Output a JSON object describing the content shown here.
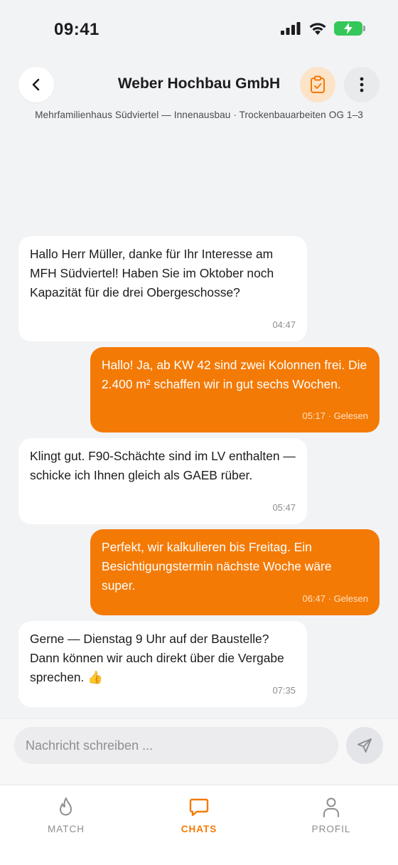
{
  "status_bar": {
    "time": "09:41"
  },
  "header": {
    "title": "Weber Hochbau GmbH",
    "subtitle": "Mehrfamilienhaus Südviertel — Innenausbau · Trockenbauarbeiten OG 1–3"
  },
  "messages": [
    {
      "direction": "in",
      "text": "Hallo Herr Müller, danke für Ihr Interesse am MFH Südviertel! Haben Sie im Oktober noch Kapazität für die drei Obergeschosse?",
      "meta": "04:47"
    },
    {
      "direction": "out",
      "text": "Hallo! Ja, ab KW 42 sind zwei Kolonnen frei. Die 2.400 m² schaffen wir in gut sechs Wochen.",
      "meta": "05:17 · Gelesen"
    },
    {
      "direction": "in",
      "text": "Klingt gut. F90-Schächte sind im LV enthalten — schicke ich Ihnen gleich als GAEB rüber.",
      "meta": "05:47"
    },
    {
      "direction": "out",
      "text": "Perfekt, wir kalkulieren bis Freitag. Ein Besichtigungstermin nächste Woche wäre super.",
      "meta": "06:47 · Gelesen"
    },
    {
      "direction": "in",
      "text": "Gerne — Dienstag 9 Uhr auf der Baustelle? Dann können wir auch direkt über die Vergabe sprechen. 👍",
      "meta": "07:35"
    }
  ],
  "composer": {
    "placeholder": "Nachricht schreiben ..."
  },
  "tabs": [
    {
      "label": "MATCH",
      "icon": "flame-icon",
      "active": false
    },
    {
      "label": "CHATS",
      "icon": "chat-bubble-icon",
      "active": true
    },
    {
      "label": "PROFIL",
      "icon": "person-icon",
      "active": false
    }
  ],
  "colors": {
    "accent": "#f47a06",
    "battery": "#34c759",
    "doc_button_bg": "#fde3c8"
  }
}
